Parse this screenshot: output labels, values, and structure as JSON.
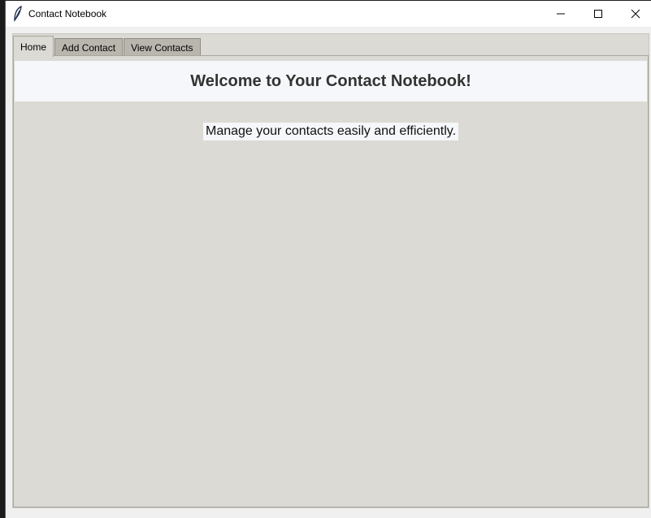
{
  "window": {
    "title": "Contact Notebook"
  },
  "tabs": [
    {
      "label": "Home",
      "active": true
    },
    {
      "label": "Add Contact",
      "active": false
    },
    {
      "label": "View Contacts",
      "active": false
    }
  ],
  "home": {
    "heading": "Welcome to Your Contact Notebook!",
    "subtitle": "Manage your contacts easily and efficiently."
  },
  "colors": {
    "panel_bg": "#dcdad5",
    "header_bg": "#f5f7fa",
    "heading_text": "#333333"
  },
  "icons": {
    "app": "feather-icon",
    "minimize": "minimize-icon",
    "maximize": "maximize-icon",
    "close": "close-icon"
  }
}
